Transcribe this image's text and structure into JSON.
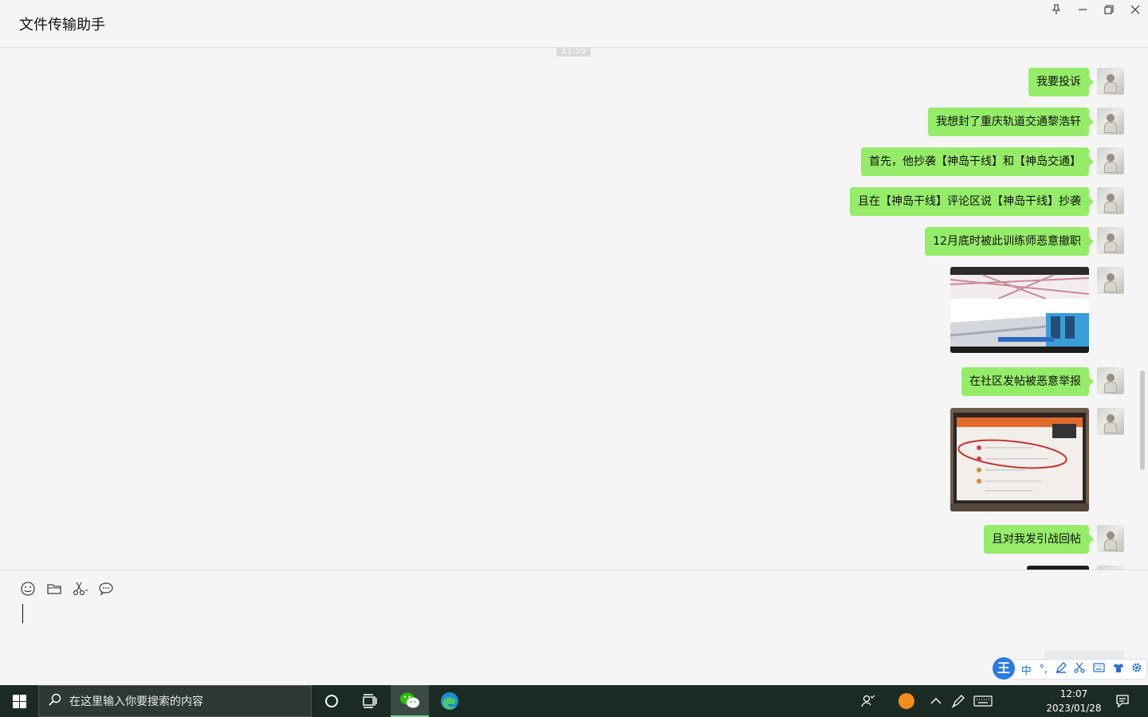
{
  "window": {
    "title": "文件传输助手",
    "controls": [
      "pin-icon",
      "minimize-icon",
      "restore-icon",
      "close-icon"
    ]
  },
  "chat": {
    "timestamp": "11:55",
    "messages": [
      {
        "type": "text",
        "text": "我要投诉"
      },
      {
        "type": "text",
        "text": "我想封了重庆轨道交通黎浩轩"
      },
      {
        "type": "text",
        "text": "首先，他抄袭【神岛干线】和【神岛交通】"
      },
      {
        "type": "text",
        "text": "且在【神岛干线】评论区说【神岛干线】抄袭"
      },
      {
        "type": "text",
        "text": "12月底时被此训练师恶意撤职"
      },
      {
        "type": "image",
        "description": "station-screenshot"
      },
      {
        "type": "text",
        "text": "在社区发帖被恶意举报"
      },
      {
        "type": "image",
        "description": "laptop-photo"
      },
      {
        "type": "text",
        "text": "且对我发引战回帖"
      }
    ]
  },
  "composer": {
    "tools": [
      "emoji-icon",
      "folder-icon",
      "scissors-icon",
      "chat-history-icon"
    ]
  },
  "ime": {
    "logo": "王",
    "mode": "中",
    "punct": "°,",
    "items": [
      "pen-icon",
      "scissors-icon",
      "keyboard-icon",
      "shirt-icon",
      "gear-icon"
    ]
  },
  "taskbar": {
    "search_placeholder": "在这里输入你要搜索的内容",
    "time": "12:07",
    "date": "2023/01/28",
    "apps": [
      "cortana-icon",
      "task-view-icon",
      "wechat-icon",
      "edge-icon"
    ]
  },
  "colors": {
    "bubble": "#95ec69",
    "background": "#f5f5f5",
    "taskbar": "#1c2a24"
  }
}
